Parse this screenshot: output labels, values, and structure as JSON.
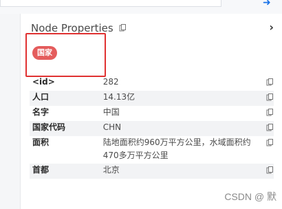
{
  "panel": {
    "title": "Node Properties",
    "label": "国家"
  },
  "properties": [
    {
      "key": "<id>",
      "value": "282"
    },
    {
      "key": "人口",
      "value": "14.13亿"
    },
    {
      "key": "名字",
      "value": "中国"
    },
    {
      "key": "国家代码",
      "value": "CHN"
    },
    {
      "key": "面积",
      "value": "陆地面积约960万平方公里，水域面积约470多万平方公里"
    },
    {
      "key": "首都",
      "value": "北京"
    }
  ],
  "watermark": "CSDN @ 默",
  "icons": {
    "copy": "copy-icon",
    "expand": "chevron-right-icon",
    "send": "send-icon"
  },
  "colors": {
    "badge": "#e45c5c",
    "highlight": "#e03131",
    "accent": "#1a73e8"
  }
}
